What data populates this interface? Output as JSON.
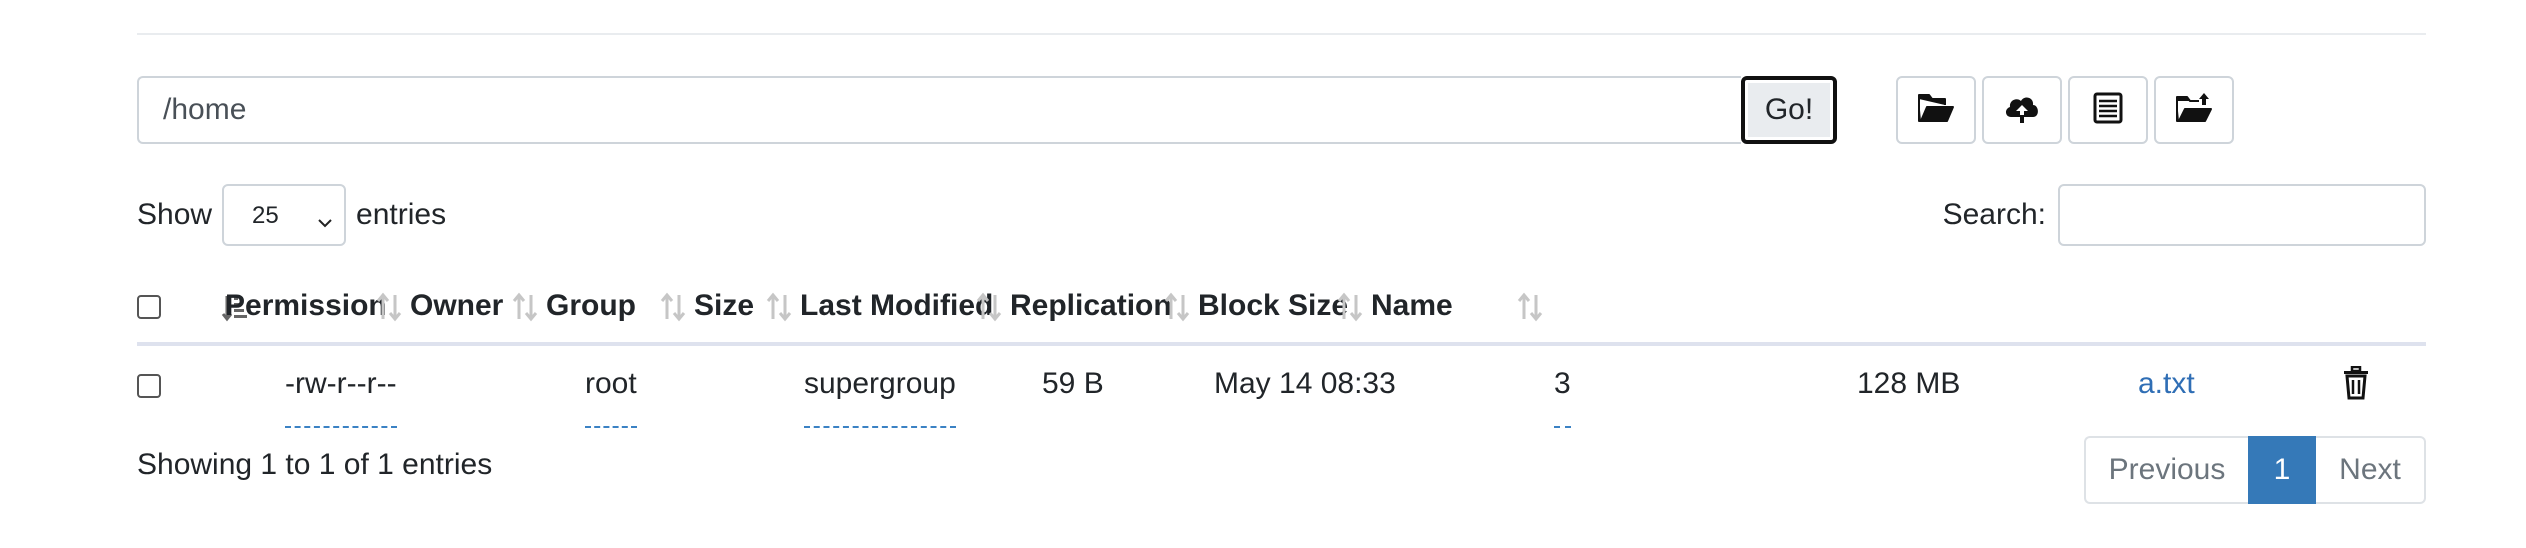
{
  "path_bar": {
    "value": "/home",
    "go_label": "Go!"
  },
  "toolbar": {
    "icons": [
      "folder-open-icon",
      "cloud-upload-icon",
      "list-icon",
      "folder-upload-icon"
    ]
  },
  "length": {
    "show_label": "Show",
    "selected": "25",
    "entries_label": "entries"
  },
  "search": {
    "label": "Search:",
    "value": ""
  },
  "table": {
    "columns": [
      "Permission",
      "Owner",
      "Group",
      "Size",
      "Last Modified",
      "Replication",
      "Block Size",
      "Name"
    ],
    "rows": [
      {
        "permission": "-rw-r--r--",
        "owner": "root",
        "group": "supergroup",
        "size": "59 B",
        "last_modified": "May 14 08:33",
        "replication": "3",
        "block_size": "128 MB",
        "name": "a.txt"
      }
    ]
  },
  "info": "Showing 1 to 1 of 1 entries",
  "pagination": {
    "previous": "Previous",
    "current": "1",
    "next": "Next",
    "active_color": "#3579b8"
  },
  "colors": {
    "link": "#2f6eb5",
    "border": "#ced4da"
  }
}
